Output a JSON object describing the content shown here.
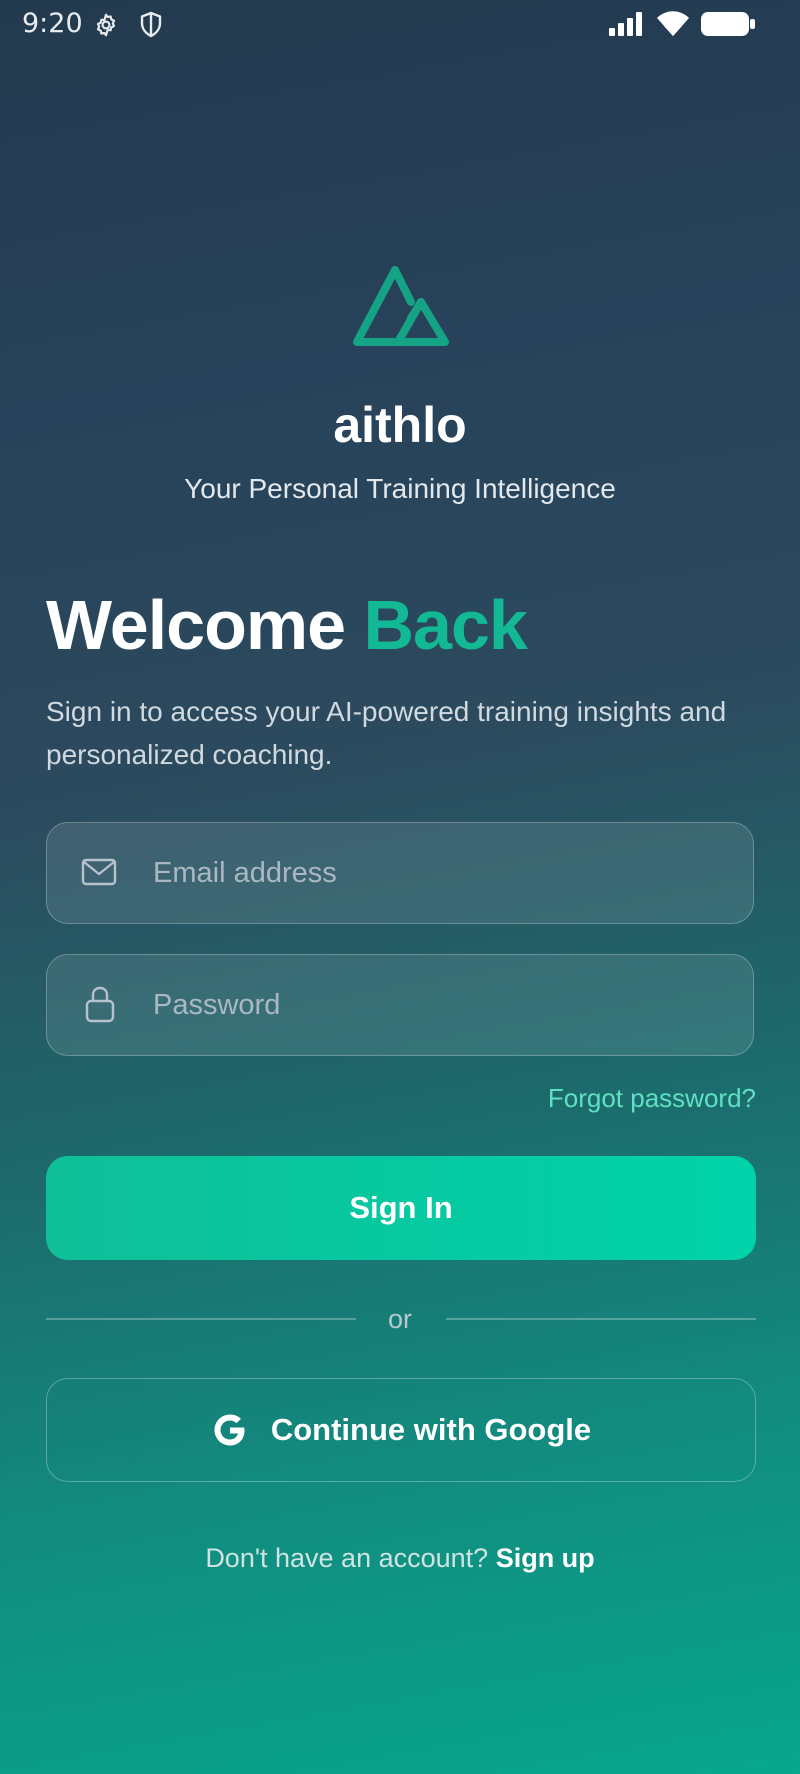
{
  "status_bar": {
    "time": "9:20",
    "icons": [
      "settings-icon",
      "shield-icon",
      "signal-icon",
      "wifi-icon",
      "battery-icon"
    ]
  },
  "brand": {
    "logo_icon": "mountain-logo-icon",
    "name": "aithlo",
    "tagline": "Your Personal Training Intelligence",
    "accent_color": "#13b994"
  },
  "heading": {
    "part1": "Welcome",
    "part2": "Back",
    "subtitle": "Sign in to access your AI-powered training insights and personalized coaching."
  },
  "form": {
    "email": {
      "icon": "mail-icon",
      "placeholder": "Email address",
      "value": ""
    },
    "password": {
      "icon": "lock-icon",
      "placeholder": "Password",
      "value": ""
    },
    "forgot_label": "Forgot password?",
    "signin_label": "Sign In",
    "signin_color": "#00d3aa"
  },
  "divider": {
    "text": "or"
  },
  "google": {
    "icon": "google-icon",
    "label": "Continue with Google"
  },
  "signup": {
    "prompt": "Don't have an account?",
    "link": "Sign up"
  }
}
